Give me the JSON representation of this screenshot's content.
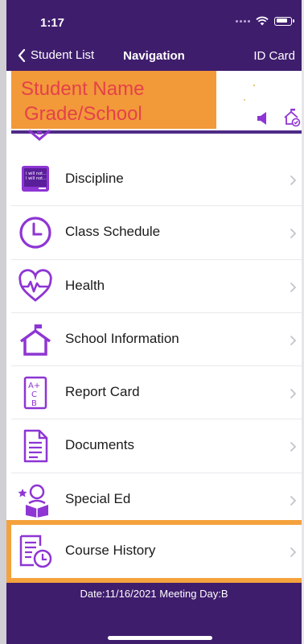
{
  "status_bar": {
    "time": "1:17"
  },
  "nav": {
    "back_label": "Student List",
    "title": "Navigation",
    "right_label": "ID Card"
  },
  "student": {
    "name": "Student Name",
    "grade_school": "Grade/School"
  },
  "menu": {
    "items": [
      {
        "label": "Discipline",
        "icon": "chalkboard-icon"
      },
      {
        "label": "Class Schedule",
        "icon": "clock-icon"
      },
      {
        "label": "Health",
        "icon": "heart-pulse-icon"
      },
      {
        "label": "School Information",
        "icon": "school-building-icon"
      },
      {
        "label": "Report Card",
        "icon": "grades-icon"
      },
      {
        "label": "Documents",
        "icon": "document-icon"
      },
      {
        "label": "Special Ed",
        "icon": "student-reading-icon"
      },
      {
        "label": "Course History",
        "icon": "course-history-icon"
      }
    ],
    "chalkboard_text": "I will not..."
  },
  "report_card_icon_text": {
    "a": "A+",
    "c": "C",
    "b": "B"
  },
  "footer": {
    "text": "Date:11/16/2021 Meeting Day:B"
  },
  "colors": {
    "header_purple": "#3f1d6d",
    "icon_purple": "#8e35d4",
    "highlight_orange": "#f4a23d",
    "banner_orange": "#f2993a",
    "banner_text_red": "#e3424a"
  }
}
